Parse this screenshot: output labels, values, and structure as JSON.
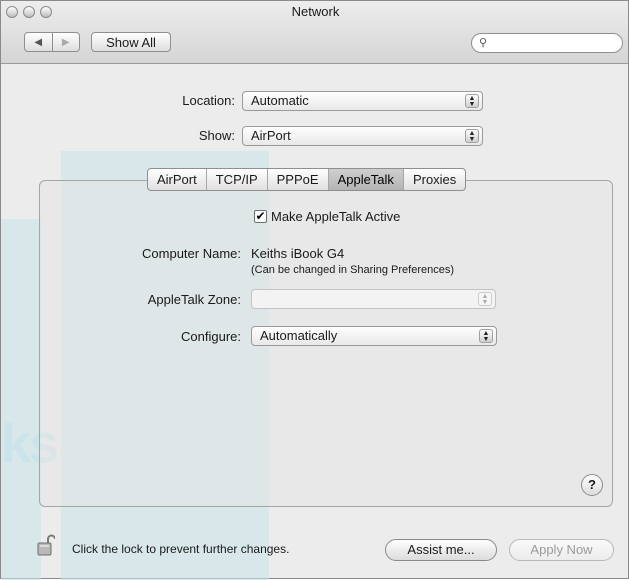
{
  "window": {
    "title": "Network"
  },
  "toolbar": {
    "show_all_label": "Show All",
    "search_placeholder": ""
  },
  "watermark_text": "ks",
  "form": {
    "location_label": "Location:",
    "location_value": "Automatic",
    "show_label": "Show:",
    "show_value": "AirPort"
  },
  "tabs": [
    {
      "label": "AirPort"
    },
    {
      "label": "TCP/IP"
    },
    {
      "label": "PPPoE"
    },
    {
      "label": "AppleTalk",
      "active": true
    },
    {
      "label": "Proxies"
    }
  ],
  "appletalk": {
    "make_active_label": "Make AppleTalk Active",
    "make_active_checked": true,
    "computer_name_label": "Computer Name:",
    "computer_name_value": "Keiths iBook G4",
    "computer_name_note": "(Can be changed in Sharing Preferences)",
    "zone_label": "AppleTalk Zone:",
    "zone_value": "",
    "configure_label": "Configure:",
    "configure_value": "Automatically"
  },
  "help_label": "?",
  "footer": {
    "lock_text": "Click the lock to prevent further changes.",
    "assist_label": "Assist me...",
    "apply_label": "Apply Now"
  }
}
